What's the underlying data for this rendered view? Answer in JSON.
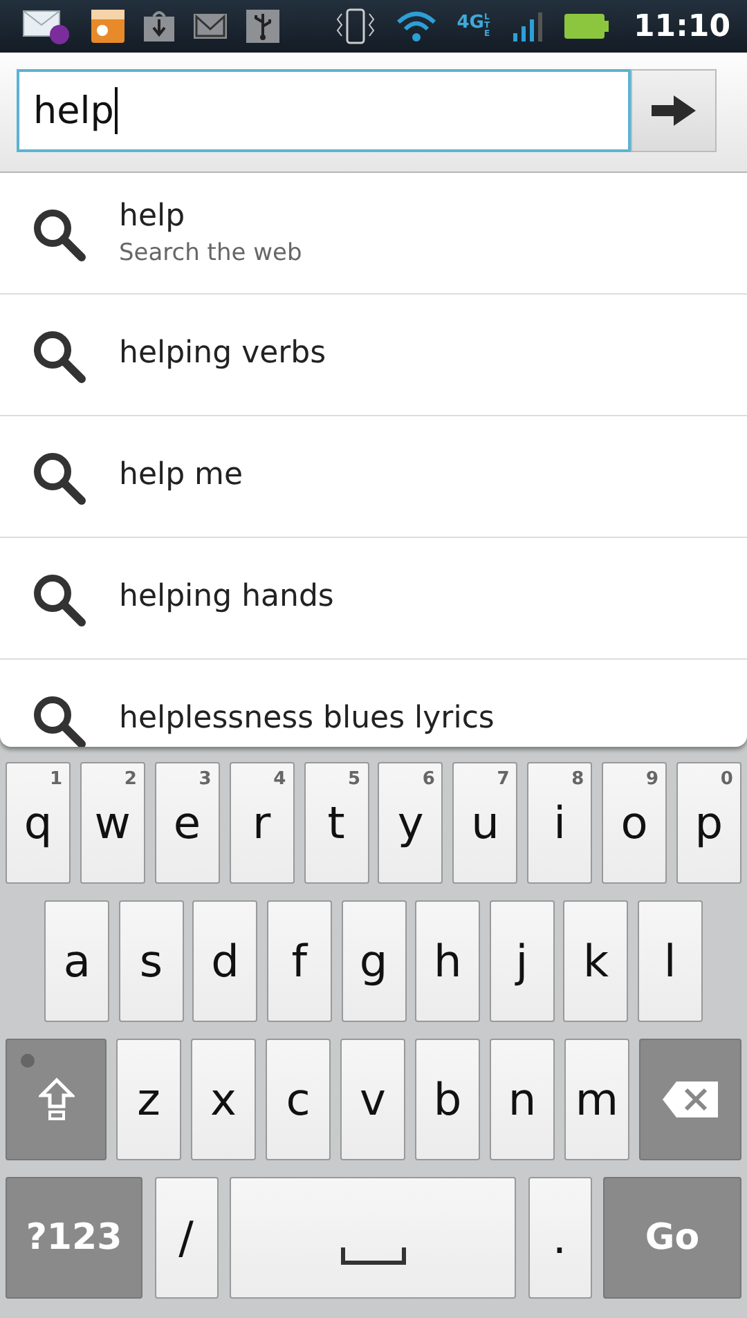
{
  "status_bar": {
    "network": "4G",
    "network_sub": "LTE",
    "time": "11:10"
  },
  "search": {
    "value": "help"
  },
  "suggestions": [
    {
      "text": "help",
      "subtext": "Search the web"
    },
    {
      "text": "helping verbs"
    },
    {
      "text": "help me"
    },
    {
      "text": "helping hands"
    },
    {
      "text": "helplessness blues lyrics"
    }
  ],
  "keyboard": {
    "rows": [
      [
        {
          "kind": "letter",
          "label": "q",
          "hint": "1"
        },
        {
          "kind": "letter",
          "label": "w",
          "hint": "2"
        },
        {
          "kind": "letter",
          "label": "e",
          "hint": "3"
        },
        {
          "kind": "letter",
          "label": "r",
          "hint": "4"
        },
        {
          "kind": "letter",
          "label": "t",
          "hint": "5"
        },
        {
          "kind": "letter",
          "label": "y",
          "hint": "6"
        },
        {
          "kind": "letter",
          "label": "u",
          "hint": "7"
        },
        {
          "kind": "letter",
          "label": "i",
          "hint": "8"
        },
        {
          "kind": "letter",
          "label": "o",
          "hint": "9"
        },
        {
          "kind": "letter",
          "label": "p",
          "hint": "0"
        }
      ],
      [
        {
          "kind": "letter",
          "label": "a"
        },
        {
          "kind": "letter",
          "label": "s"
        },
        {
          "kind": "letter",
          "label": "d"
        },
        {
          "kind": "letter",
          "label": "f"
        },
        {
          "kind": "letter",
          "label": "g"
        },
        {
          "kind": "letter",
          "label": "h"
        },
        {
          "kind": "letter",
          "label": "j"
        },
        {
          "kind": "letter",
          "label": "k"
        },
        {
          "kind": "letter",
          "label": "l"
        }
      ],
      [
        {
          "kind": "shift",
          "on": false
        },
        {
          "kind": "letter",
          "label": "z"
        },
        {
          "kind": "letter",
          "label": "x"
        },
        {
          "kind": "letter",
          "label": "c"
        },
        {
          "kind": "letter",
          "label": "v"
        },
        {
          "kind": "letter",
          "label": "b"
        },
        {
          "kind": "letter",
          "label": "n"
        },
        {
          "kind": "letter",
          "label": "m"
        },
        {
          "kind": "backspace"
        }
      ],
      [
        {
          "kind": "symbols",
          "label": "?123"
        },
        {
          "kind": "letter",
          "label": "/"
        },
        {
          "kind": "space"
        },
        {
          "kind": "letter",
          "label": "."
        },
        {
          "kind": "go",
          "label": "Go"
        }
      ]
    ]
  }
}
